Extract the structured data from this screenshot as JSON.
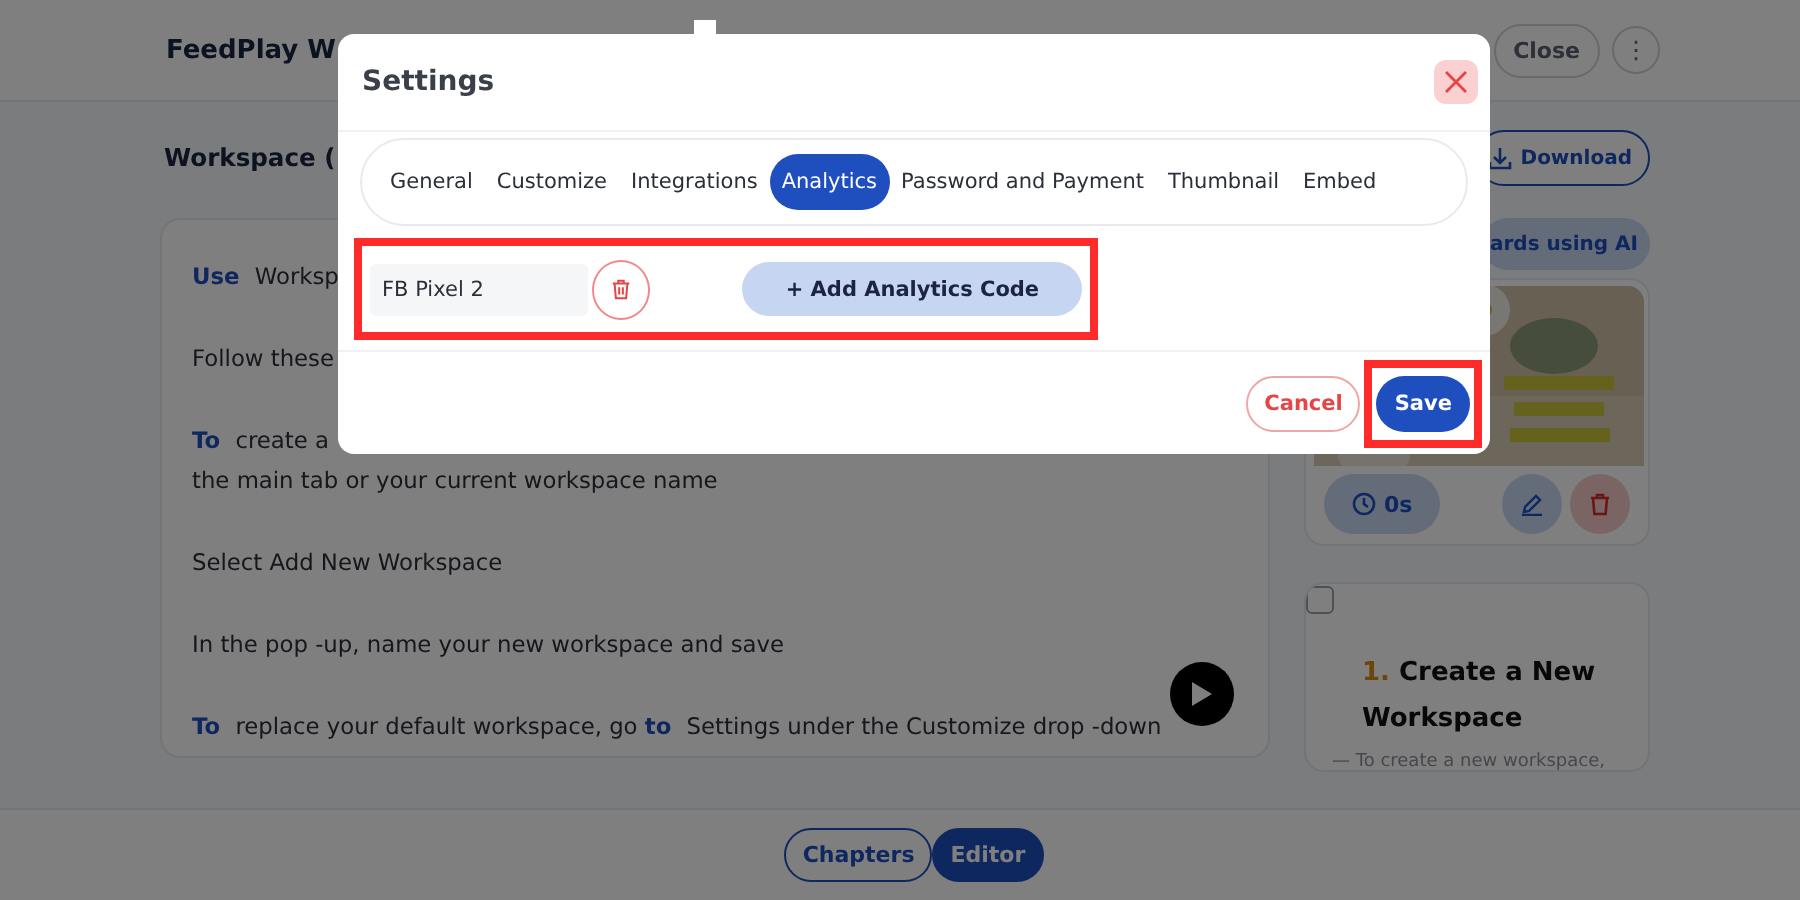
{
  "header": {
    "title": "FeedPlay W",
    "close_button": "Close",
    "more_button": "⋮"
  },
  "workspace": {
    "title": "Workspace (",
    "download_button": "Download",
    "ai_button": "ards using AI"
  },
  "editor": {
    "paragraphs": [
      {
        "text": "**Use** Worksp"
      },
      {
        "text": "Follow these"
      },
      {
        "text": "**To** create a"
      },
      {
        "text": "the main tab or your current workspace name"
      },
      {
        "text": "Select Add New Workspace"
      },
      {
        "text": "In the pop -up, name your new workspace and save"
      },
      {
        "text": "**To** replace your default workspace, go **to** Settings under the Customize drop -down"
      }
    ]
  },
  "video_card": {
    "duration": "0s"
  },
  "chapter_card": {
    "checked": false,
    "number": "1.",
    "title": "Create a New Workspace",
    "summary": "— To create a new workspace,"
  },
  "view_tabs": [
    {
      "label": "Chapters",
      "selected": false
    },
    {
      "label": "Editor",
      "selected": true
    }
  ],
  "modal": {
    "title": "Settings",
    "tabs": [
      {
        "label": "General",
        "selected": false
      },
      {
        "label": "Customize",
        "selected": false
      },
      {
        "label": "Integrations",
        "selected": false
      },
      {
        "label": "Analytics",
        "selected": true
      },
      {
        "label": "Password and Payment",
        "selected": false
      },
      {
        "label": "Thumbnail",
        "selected": false
      },
      {
        "label": "Embed",
        "selected": false
      }
    ],
    "codes": [
      {
        "value": "FB Pixel 2"
      }
    ],
    "codes_highlighted": true,
    "add_button": "+ Add Analytics Code",
    "cancel_button": "Cancel",
    "save_button": "Save",
    "save_highlighted": true
  }
}
